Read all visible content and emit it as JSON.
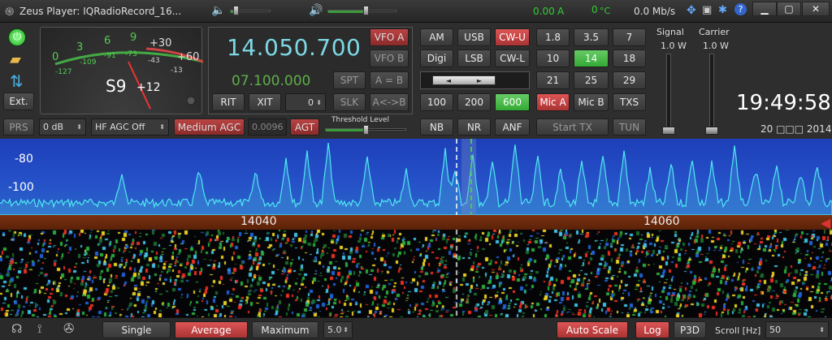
{
  "titlebar": {
    "title": "Zeus Player: IQRadioRecord_16...",
    "current": "0.00",
    "current_unit": "A",
    "temp": "0",
    "temp_unit": "°C",
    "rate": "0.0 Mb/s",
    "volume1_level": 0.12,
    "volume2_level": 0.55
  },
  "left": {
    "power_icon": "power-icon",
    "open_icon": "folder-icon",
    "sync_icon": "swap-icon",
    "ext_label": "Ext."
  },
  "meter": {
    "s_reading": "S9",
    "over": "+12",
    "scale_top": [
      "0",
      "3",
      "6",
      "9",
      "+30",
      "+60"
    ],
    "scale_bottom": [
      "-127",
      "-109",
      "-91",
      "-73",
      "-43",
      "-13"
    ]
  },
  "freq": {
    "main": "14.050.700",
    "sub": "07.100.000",
    "vfo_a": "VFO A",
    "vfo_b": "VFO B",
    "spt": "SPT",
    "a_eq_b": "A = B",
    "rit": "RIT",
    "xit": "XIT",
    "offset": "0",
    "slk": "SLK",
    "swap": "A<->B"
  },
  "agc": {
    "prs": "PRS",
    "preamp": "0 dB",
    "hf_agc": "HF AGC Off",
    "medium_agc": "Medium AGC",
    "agc_value": "0.0096",
    "agt": "AGT",
    "threshold_label": "Threshold Level",
    "threshold_level": 0.5
  },
  "modes": {
    "row1": [
      "AM",
      "USB",
      "CW-U"
    ],
    "row2": [
      "Digi",
      "LSB",
      "CW-L"
    ],
    "filters": [
      "100",
      "200",
      "600"
    ],
    "nb": "NB",
    "nr": "NR",
    "anf": "ANF"
  },
  "bands": {
    "row1": [
      "1.8",
      "3.5",
      "7"
    ],
    "row2": [
      "10",
      "14",
      "18"
    ],
    "row3": [
      "21",
      "25",
      "29"
    ],
    "mic_a": "Mic A",
    "mic_b": "Mic B",
    "txs": "TXS",
    "start_tx": "Start TX",
    "tun": "TUN"
  },
  "power": {
    "signal_label": "Signal",
    "signal_value": "1.0 W",
    "carrier_label": "Carrier",
    "carrier_value": "1.0 W"
  },
  "clock": {
    "time": "19:49:58",
    "date": "20 □□□ 2014"
  },
  "spectrum": {
    "db_labels": [
      "-80",
      "-100"
    ],
    "freq_labels": [
      "14040",
      "14060"
    ]
  },
  "bottom": {
    "single": "Single",
    "average": "Average",
    "maximum": "Maximum",
    "avg_value": "5.0",
    "auto_scale": "Auto Scale",
    "log": "Log",
    "p3d": "P3D",
    "scroll_label": "Scroll [Hz]",
    "scroll_value": "50"
  },
  "colors": {
    "accent_red": "#cc4444",
    "accent_green": "#44aa44",
    "lcd_cyan": "#7cd9e6",
    "lcd_green": "#5fae4a"
  }
}
